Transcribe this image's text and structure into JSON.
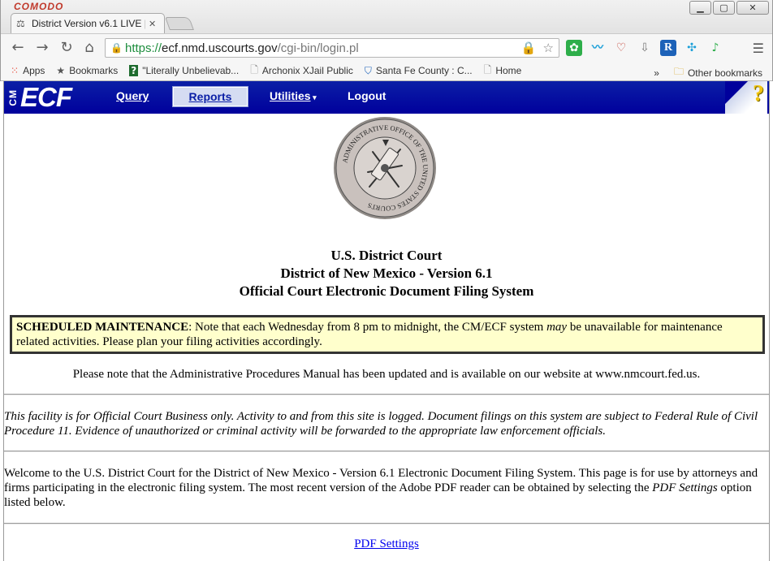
{
  "browser": {
    "brand": "COMODO",
    "tab_title": "District Version v6.1 LIVE |",
    "url_scheme": "https://",
    "url_host": "ecf.nmd.uscourts.gov",
    "url_path": "/cgi-bin/login.pl",
    "bookmarks": [
      {
        "label": "Apps",
        "icon": "apps-icon"
      },
      {
        "label": "Bookmarks",
        "icon": "star-icon"
      },
      {
        "label": "\"Literally Unbelievab...",
        "icon": "question-icon"
      },
      {
        "label": "Archonix XJail Public",
        "icon": "page-icon"
      },
      {
        "label": "Santa Fe County : C...",
        "icon": "shield-icon"
      },
      {
        "label": "Home",
        "icon": "page-icon"
      }
    ],
    "overflow": "»",
    "other_bookmarks": "Other bookmarks"
  },
  "ecf": {
    "logo_cm": "CM",
    "logo_ecf": "ECF",
    "nav": {
      "query": "Query",
      "reports": "Reports",
      "utilities": "Utilities",
      "logout": "Logout"
    },
    "help": "?"
  },
  "court": {
    "line1": "U.S. District Court",
    "line2": "District of New Mexico - Version 6.1",
    "line3": "Official Court Electronic Document Filing System"
  },
  "maintenance": {
    "heading": "SCHEDULED MAINTENANCE",
    "text_a": ": Note that each Wednesday from 8 pm to midnight, the CM/ECF system ",
    "text_may": "may",
    "text_b": " be unavailable for maintenance related activities. Please plan your filing activities accordingly."
  },
  "notice": "Please note that the Administrative Procedures Manual has been updated and is available on our website at www.nmcourt.fed.us.",
  "disclaimer": "This facility is for Official Court Business only. Activity to and from this site is logged. Document filings on this system are subject to Federal Rule of Civil Procedure 11. Evidence of unauthorized or criminal activity will be forwarded to the appropriate law enforcement officials.",
  "welcome": {
    "text_a": "Welcome to the U.S. District Court for the District of New Mexico - Version 6.1 Electronic Document Filing System. This page is for use by attorneys and firms participating in the electronic filing system. The most recent version of the Adobe PDF reader can be obtained by selecting the ",
    "text_pdf": "PDF Settings",
    "text_b": " option listed below."
  },
  "links": {
    "pdf_settings": "PDF Settings"
  },
  "seal": {
    "inscription": "ADMINISTRATIVE OFFICE OF THE UNITED STATES COURTS"
  },
  "colors": {
    "ecf_blue": "#00009c",
    "maintenance_bg": "#ffffcc",
    "link": "#0000ee"
  }
}
